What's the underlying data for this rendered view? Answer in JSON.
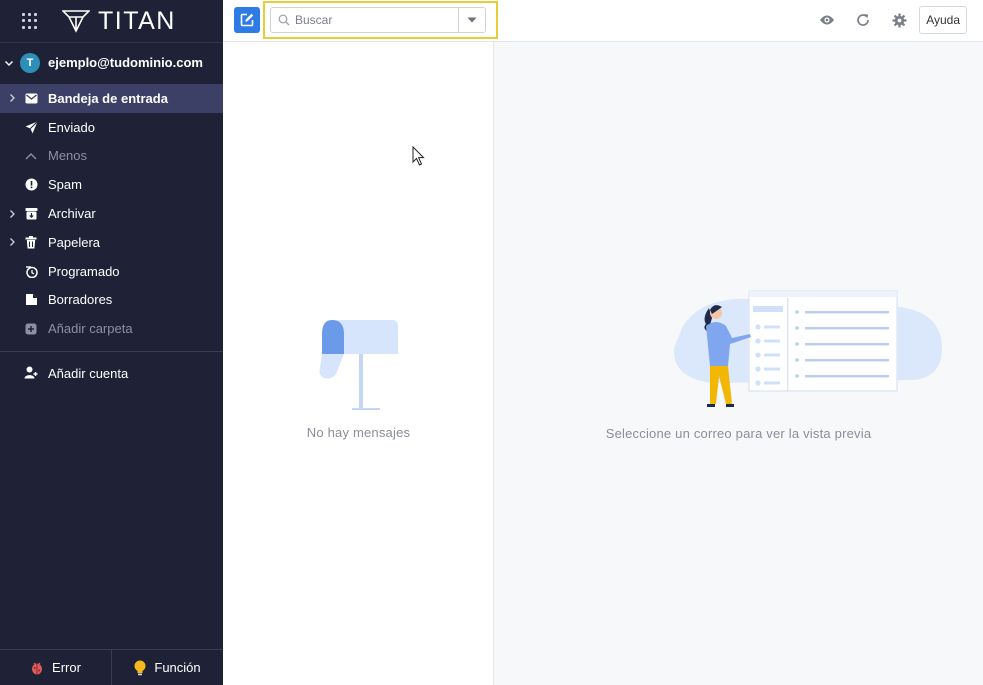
{
  "brand": {
    "name": "TITAN"
  },
  "account": {
    "initial": "T",
    "email": "ejemplo@tudominio.com"
  },
  "folders": [
    {
      "label": "Bandeja de entrada",
      "icon": "envelope-icon",
      "active": true,
      "expandable": true
    },
    {
      "label": "Enviado",
      "icon": "paper-plane-icon",
      "expandable": false
    },
    {
      "label": "Menos",
      "icon": "chevron-up-icon",
      "muted": true
    },
    {
      "label": "Spam",
      "icon": "alert-circle-icon",
      "expandable": false
    },
    {
      "label": "Archivar",
      "icon": "archive-icon",
      "expandable": true
    },
    {
      "label": "Papelera",
      "icon": "trash-icon",
      "expandable": true
    },
    {
      "label": "Programado",
      "icon": "clock-send-icon",
      "expandable": false
    },
    {
      "label": "Borradores",
      "icon": "draft-icon",
      "expandable": false
    },
    {
      "label": "Añadir carpeta",
      "icon": "plus-square-icon",
      "muted": true
    }
  ],
  "add_account": {
    "label": "Añadir cuenta"
  },
  "footer": {
    "error_label": "Error",
    "feature_label": "Función"
  },
  "search": {
    "placeholder": "Buscar"
  },
  "toolbar": {
    "help_label": "Ayuda"
  },
  "list": {
    "empty_message": "No hay mensajes"
  },
  "preview": {
    "empty_message": "Seleccione un correo para ver la vista previa"
  },
  "colors": {
    "sidebar_bg": "#1f2237",
    "active_item_bg": "#3c3f66",
    "accent_blue": "#2f7be6",
    "search_highlight": "#e9cc3a",
    "avatar_bg": "#2d8fb8",
    "illustration_blue": "#cfe0fb",
    "illustration_yellow": "#f2b705"
  }
}
